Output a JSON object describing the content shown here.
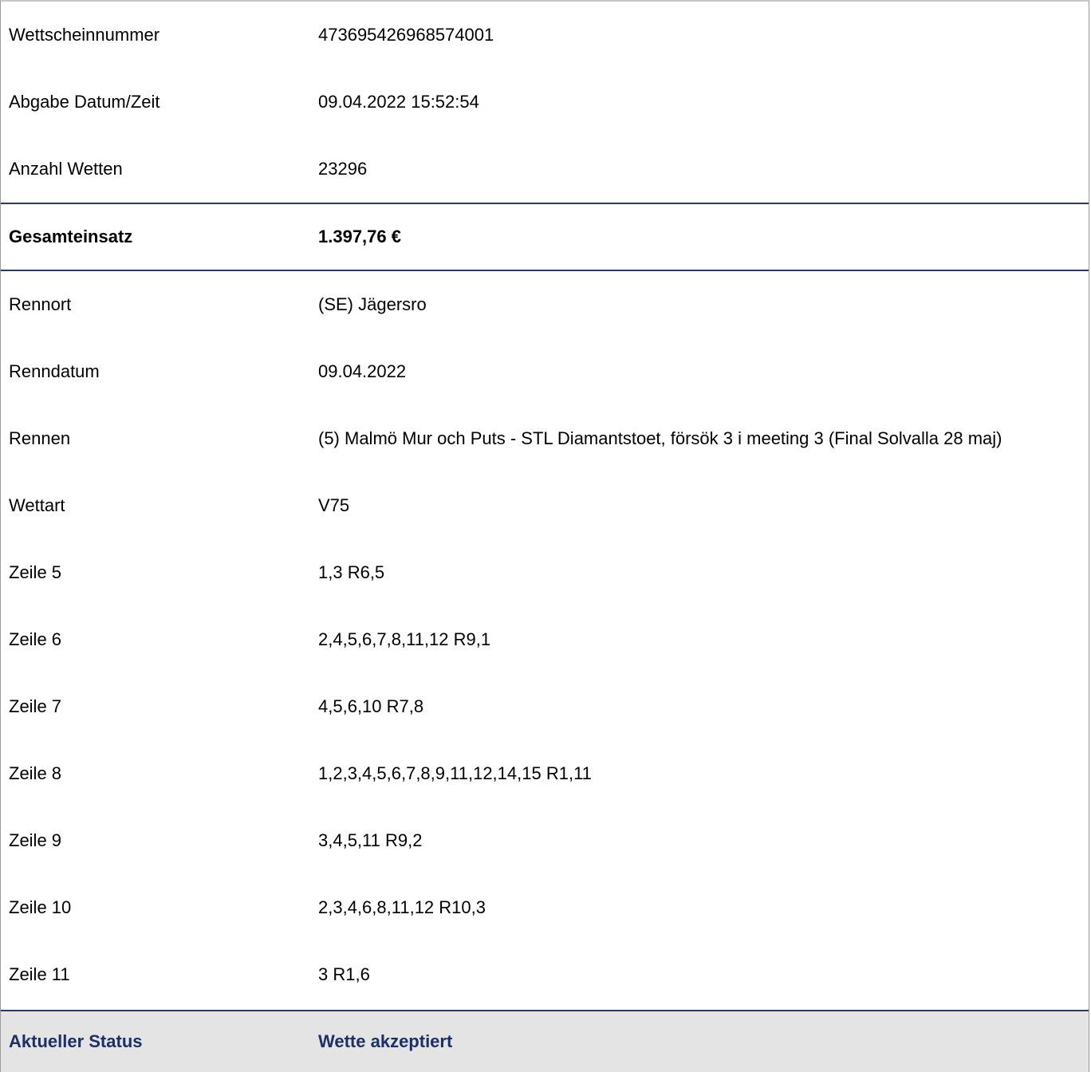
{
  "ticket": {
    "top_rows": [
      {
        "label": "Wettscheinnummer",
        "value": "473695426968574001"
      },
      {
        "label": "Abgabe Datum/Zeit",
        "value": "09.04.2022 15:52:54"
      },
      {
        "label": "Anzahl Wetten",
        "value": "23296"
      }
    ],
    "total": {
      "label": "Gesamteinsatz",
      "value": "1.397,76 €"
    },
    "detail_rows": [
      {
        "label": "Rennort",
        "value": "(SE) Jägersro"
      },
      {
        "label": "Renndatum",
        "value": "09.04.2022"
      },
      {
        "label": "Rennen",
        "value": "(5) Malmö Mur och Puts - STL Diamantstoet, försök 3 i meeting 3 (Final Solvalla 28 maj)"
      },
      {
        "label": "Wettart",
        "value": "V75"
      },
      {
        "label": "Zeile 5",
        "value": "1,3 R6,5"
      },
      {
        "label": "Zeile 6",
        "value": "2,4,5,6,7,8,11,12 R9,1"
      },
      {
        "label": "Zeile 7",
        "value": "4,5,6,10 R7,8"
      },
      {
        "label": "Zeile 8",
        "value": "1,2,3,4,5,6,7,8,9,11,12,14,15 R1,11"
      },
      {
        "label": "Zeile 9",
        "value": "3,4,5,11 R9,2"
      },
      {
        "label": "Zeile 10",
        "value": "2,3,4,6,8,11,12 R10,3"
      },
      {
        "label": "Zeile 11",
        "value": "3 R1,6"
      }
    ],
    "status": {
      "label": "Aktueller Status",
      "value": "Wette akzeptiert"
    }
  },
  "colors": {
    "divider": "#2a3a66",
    "status_text": "#1c2f66",
    "status_background": "#e4e4e4"
  }
}
